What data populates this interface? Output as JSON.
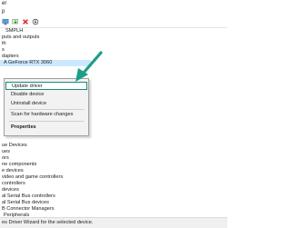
{
  "window": {
    "title": "er"
  },
  "menu": {
    "items": [
      "p"
    ]
  },
  "tree": {
    "rows": [
      {
        "label": "SMPLH"
      },
      {
        "label": "puts and outputs"
      },
      {
        "label": "th"
      },
      {
        "label": "s"
      },
      {
        "label": "dapters"
      },
      {
        "label": "A GeForce RTX 3060"
      },
      {
        "label": ""
      },
      {
        "label": ""
      },
      {
        "label": ""
      },
      {
        "label": ""
      },
      {
        "label": ""
      },
      {
        "label": ""
      },
      {
        "label": ""
      },
      {
        "label": ""
      },
      {
        "label": ""
      },
      {
        "label": "ue Devices"
      },
      {
        "label": "ues"
      },
      {
        "label": "ors"
      },
      {
        "label": "ne components"
      },
      {
        "label": "e devices"
      },
      {
        "label": "video and game controllers"
      },
      {
        "label": "controllers"
      },
      {
        "label": "devices"
      },
      {
        "label": "al Serial Bus controllers"
      },
      {
        "label": "al Serial Bus devices"
      },
      {
        "label": "B Connector Managers"
      },
      {
        "label": "Peripherals"
      }
    ]
  },
  "context_menu": {
    "items": [
      "Update driver",
      "Disable device",
      "Uninstall device",
      "Scan for hardware changes",
      "Properties"
    ]
  },
  "status": {
    "text": "es Driver Wizard for the selected device."
  },
  "colors": {
    "accent": "#1b9e85",
    "highlight": "#cce8ff",
    "delete": "#e02020"
  },
  "icons": {
    "arrow": "teal-arrow-icon",
    "delete": "red-x-icon",
    "monitor": "monitor-icon",
    "download": "download-icon"
  }
}
